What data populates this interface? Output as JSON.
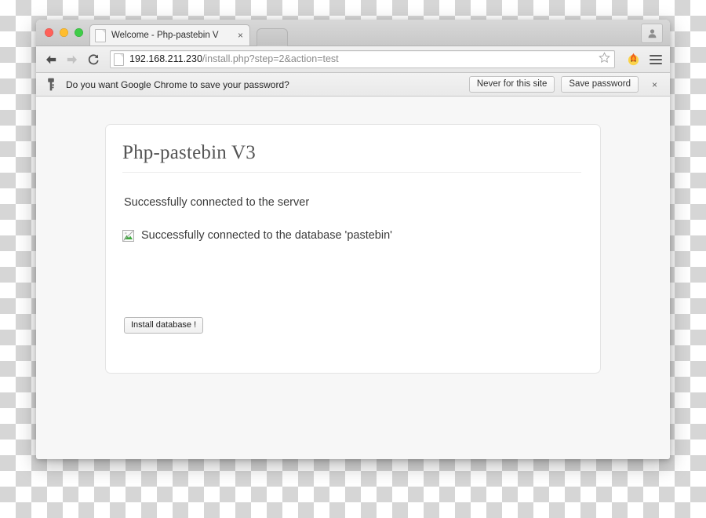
{
  "browser": {
    "tab": {
      "title": "Welcome - Php-pastebin V",
      "close_label": "×",
      "favicon": "page-icon"
    },
    "toolbar": {
      "back_icon": "back-arrow-icon",
      "forward_icon": "forward-arrow-icon",
      "reload_icon": "reload-icon",
      "url_host": "192.168.211.230",
      "url_path": "/install.php?step=2&action=test",
      "star_icon": "star-icon",
      "extension_icon": "flame-icon",
      "menu_icon": "hamburger-menu-icon"
    },
    "profile_icon": "person-avatar-icon",
    "window_controls": {
      "close": "close-window-button",
      "minimize": "minimize-window-button",
      "zoom": "zoom-window-button"
    },
    "infobar": {
      "icon": "key-icon",
      "message": "Do you want Google Chrome to save your password?",
      "never_label": "Never for this site",
      "save_label": "Save password",
      "close_label": "×"
    }
  },
  "page": {
    "title": "Php-pastebin V3",
    "messages": [
      {
        "text": "Successfully connected to the server",
        "icon": null
      },
      {
        "text": "Successfully connected to the database 'pastebin'",
        "icon": "broken-image-icon"
      }
    ],
    "install_button_label": "Install database !"
  },
  "colors": {
    "accent_green": "#3fcc48",
    "accent_red": "#ff6159",
    "accent_yellow": "#ffbd2e",
    "extension_orange": "#f06a1e",
    "text_primary": "#3b3b3b",
    "title_gray": "#555555"
  }
}
